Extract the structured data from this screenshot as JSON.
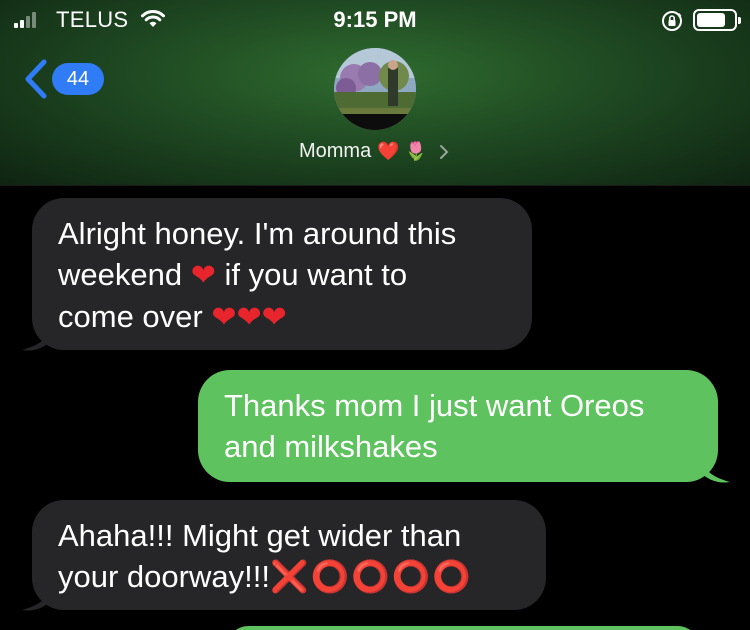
{
  "status_bar": {
    "carrier": "TELUS",
    "time": "9:15 PM",
    "signal_bars": 4,
    "signal_bars_filled": 2
  },
  "nav": {
    "back_count": "44",
    "back_icon": "chevron-left-icon"
  },
  "contact": {
    "name": "Momma",
    "emoji": "❤️ 🌷",
    "avatar_icon": "contact-photo"
  },
  "colors": {
    "incoming_bubble": "#262628",
    "outgoing_bubble": "#5ec35e",
    "badge": "#2f7cf6",
    "header_green": "#2f6b2f"
  },
  "messages": [
    {
      "direction": "incoming",
      "lines": [
        "Alright honey. I'm around this",
        "weekend",
        "if you want to",
        "come over"
      ],
      "hearts": [
        "❤",
        "❤",
        "❤",
        "❤"
      ]
    },
    {
      "direction": "outgoing",
      "lines": [
        "Thanks mom I just want Oreos",
        "and milkshakes"
      ]
    },
    {
      "direction": "incoming",
      "lines": [
        "Ahaha!!! Might get wider than",
        "your doorway!!!"
      ],
      "xo": "❌⭕⭕⭕⭕"
    }
  ]
}
